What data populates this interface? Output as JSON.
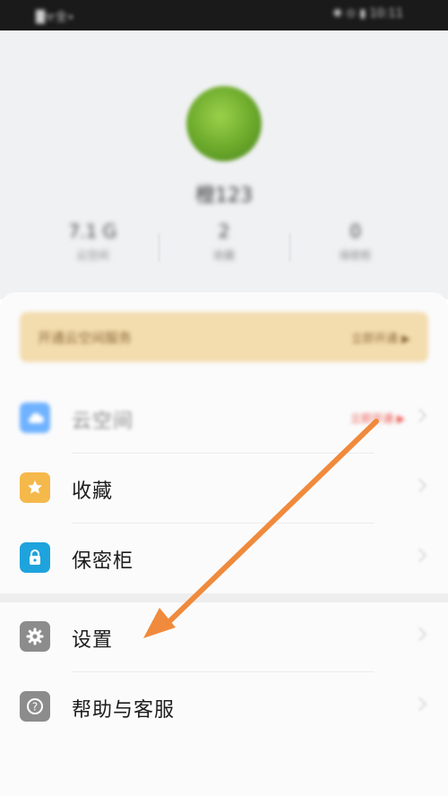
{
  "status_bar": {
    "left_text": "█ᯤ全∙",
    "right_text": "✱ ⊙ ▮ 10:11"
  },
  "profile": {
    "username": "橙123",
    "stats": [
      {
        "value": "7.1 G",
        "label": "云空间"
      },
      {
        "value": "2",
        "label": "收藏"
      },
      {
        "value": "0",
        "label": "保密柜"
      }
    ]
  },
  "banner": {
    "title": "开通云空间服务",
    "action": "立即开通 ▶"
  },
  "menu": {
    "cloud": {
      "label": "云空间",
      "badge": "立即开通 ▶"
    },
    "favorites": {
      "label": "收藏"
    },
    "vault": {
      "label": "保密柜"
    },
    "settings": {
      "label": "设置"
    },
    "help": {
      "label": "帮助与客服"
    }
  },
  "colors": {
    "accent_arrow": "#f08a3c",
    "cloud_icon": "#6fb2ff",
    "fav_icon": "#f5b84b",
    "vault_icon": "#1fa3dc",
    "settings_icon": "#8c8c8c",
    "help_icon": "#8c8c8c"
  },
  "icons": {
    "cloud": "cloud-icon",
    "favorites": "star-icon",
    "vault": "lock-icon",
    "settings": "gear-icon",
    "help": "question-icon"
  }
}
